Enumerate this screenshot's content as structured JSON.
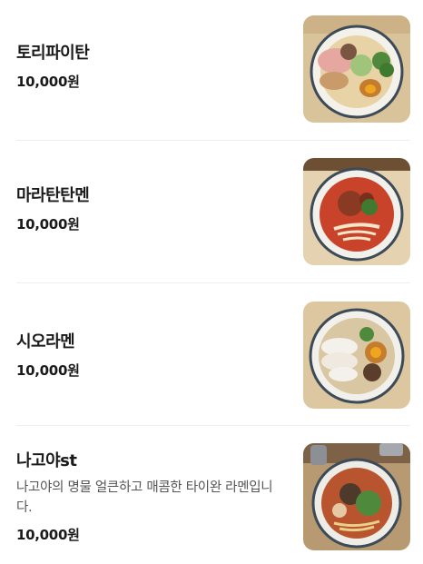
{
  "menu": {
    "items": [
      {
        "name": "토리파이탄",
        "description": "",
        "price": "10,000원",
        "image": "ramen-photo-tori-paitan"
      },
      {
        "name": "마라탄탄멘",
        "description": "",
        "price": "10,000원",
        "image": "ramen-photo-mala-tantanmen"
      },
      {
        "name": "시오라멘",
        "description": "",
        "price": "10,000원",
        "image": "ramen-photo-shio-ramen"
      },
      {
        "name": "나고야st",
        "description": "나고야의 명물 얼큰하고 매콤한 타이완 라멘입니다.",
        "price": "10,000원",
        "image": "ramen-photo-nagoya-taiwan-ramen"
      }
    ]
  }
}
